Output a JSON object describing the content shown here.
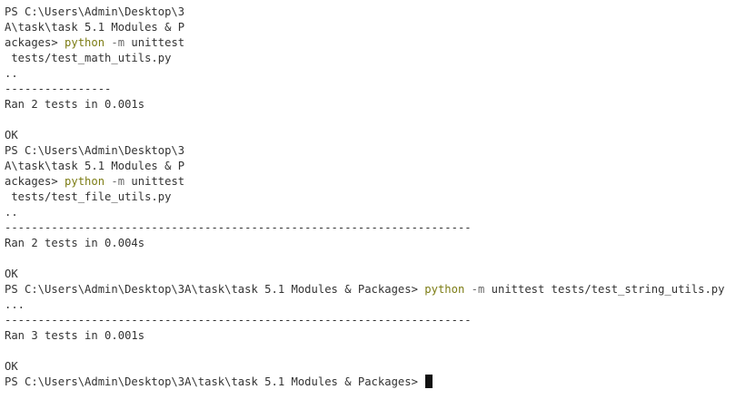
{
  "terminal": {
    "lines": [
      [
        {
          "text": "PS C:\\Users\\Admin\\Desktop\\3",
          "style": "plain"
        }
      ],
      [
        {
          "text": "A\\task\\task 5.1 Modules & P",
          "style": "plain"
        }
      ],
      [
        {
          "text": "ackages> ",
          "style": "plain"
        },
        {
          "text": "python",
          "style": "cmd"
        },
        {
          "text": " -m",
          "style": "flag"
        },
        {
          "text": " unittest",
          "style": "plain"
        }
      ],
      [
        {
          "text": " tests/test_math_utils.py",
          "style": "plain"
        }
      ],
      [
        {
          "text": "..",
          "style": "plain"
        }
      ],
      [
        {
          "text": "----------------",
          "style": "plain"
        }
      ],
      [
        {
          "text": "Ran 2 tests in 0.001s",
          "style": "plain"
        }
      ],
      [
        {
          "text": "",
          "style": "plain"
        }
      ],
      [
        {
          "text": "OK",
          "style": "plain"
        }
      ],
      [
        {
          "text": "PS C:\\Users\\Admin\\Desktop\\3",
          "style": "plain"
        }
      ],
      [
        {
          "text": "A\\task\\task 5.1 Modules & P",
          "style": "plain"
        }
      ],
      [
        {
          "text": "ackages> ",
          "style": "plain"
        },
        {
          "text": "python",
          "style": "cmd"
        },
        {
          "text": " -m",
          "style": "flag"
        },
        {
          "text": " unittest",
          "style": "plain"
        }
      ],
      [
        {
          "text": " tests/test_file_utils.py",
          "style": "plain"
        }
      ],
      [
        {
          "text": "..",
          "style": "plain"
        }
      ],
      [
        {
          "text": "----------------------------------------------------------------------",
          "style": "plain"
        }
      ],
      [
        {
          "text": "Ran 2 tests in 0.004s",
          "style": "plain"
        }
      ],
      [
        {
          "text": "",
          "style": "plain"
        }
      ],
      [
        {
          "text": "OK",
          "style": "plain"
        }
      ],
      [
        {
          "text": "PS C:\\Users\\Admin\\Desktop\\3A\\task\\task 5.1 Modules & Packages> ",
          "style": "plain"
        },
        {
          "text": "python",
          "style": "cmd"
        },
        {
          "text": " -m",
          "style": "flag"
        },
        {
          "text": " unittest tests/test_string_utils.py",
          "style": "plain"
        }
      ],
      [
        {
          "text": "...",
          "style": "plain"
        }
      ],
      [
        {
          "text": "----------------------------------------------------------------------",
          "style": "plain"
        }
      ],
      [
        {
          "text": "Ran 3 tests in 0.001s",
          "style": "plain"
        }
      ],
      [
        {
          "text": "",
          "style": "plain"
        }
      ],
      [
        {
          "text": "OK",
          "style": "plain"
        }
      ],
      [
        {
          "text": "PS C:\\Users\\Admin\\Desktop\\3A\\task\\task 5.1 Modules & Packages> ",
          "style": "plain"
        }
      ]
    ],
    "cursor_line_index": 24
  },
  "colors": {
    "background": "#ffffff",
    "text": "#333333",
    "command": "#7c7c14",
    "flag": "#6a6a6a",
    "cursor": "#111111"
  }
}
